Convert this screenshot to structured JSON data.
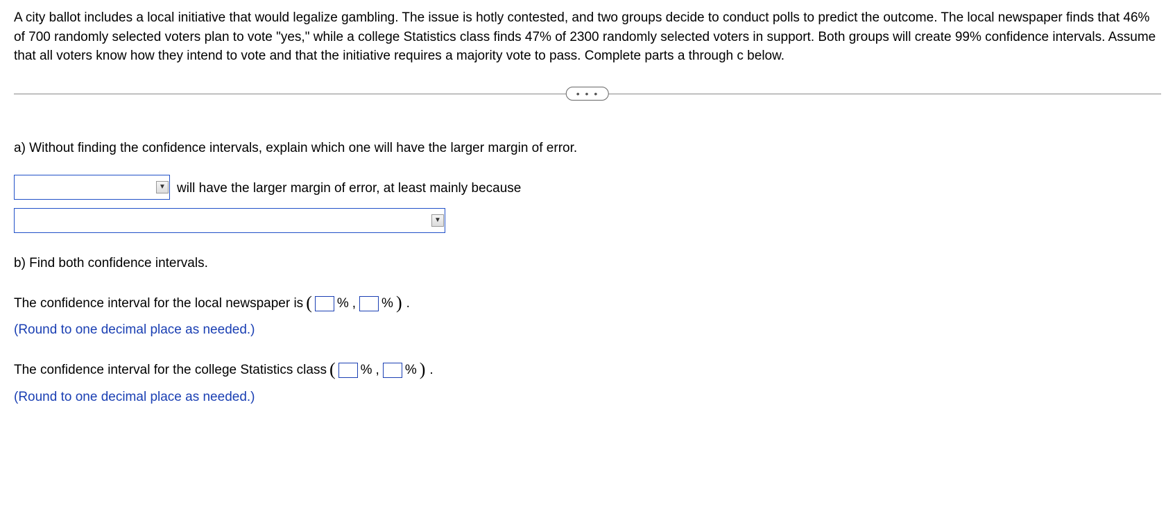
{
  "intro": "A city ballot includes a local initiative that would legalize gambling. The issue is hotly contested, and two groups decide to conduct polls to predict the outcome. The local newspaper finds that 46% of 700 randomly selected voters plan to vote \"yes,\" while a college Statistics class finds 47% of 2300 randomly selected voters in support. Both groups will create 99% confidence intervals. Assume that all voters know how they intend to vote and that the initiative requires a majority vote to pass. Complete parts a through c below.",
  "divider_dots": "• • •",
  "part_a": {
    "prompt": "a) Without finding the confidence intervals, explain which one will have the larger margin of error.",
    "after_dd1": "will have the larger margin of error, at least mainly because"
  },
  "part_b": {
    "head": "b) Find both confidence intervals.",
    "newspaper_label": "The confidence interval for the local newspaper is",
    "stats_label": "The confidence interval for the college Statistics class",
    "round": "(Round to one decimal place as needed.)",
    "pct": "%",
    "comma": ",",
    "period": "."
  }
}
